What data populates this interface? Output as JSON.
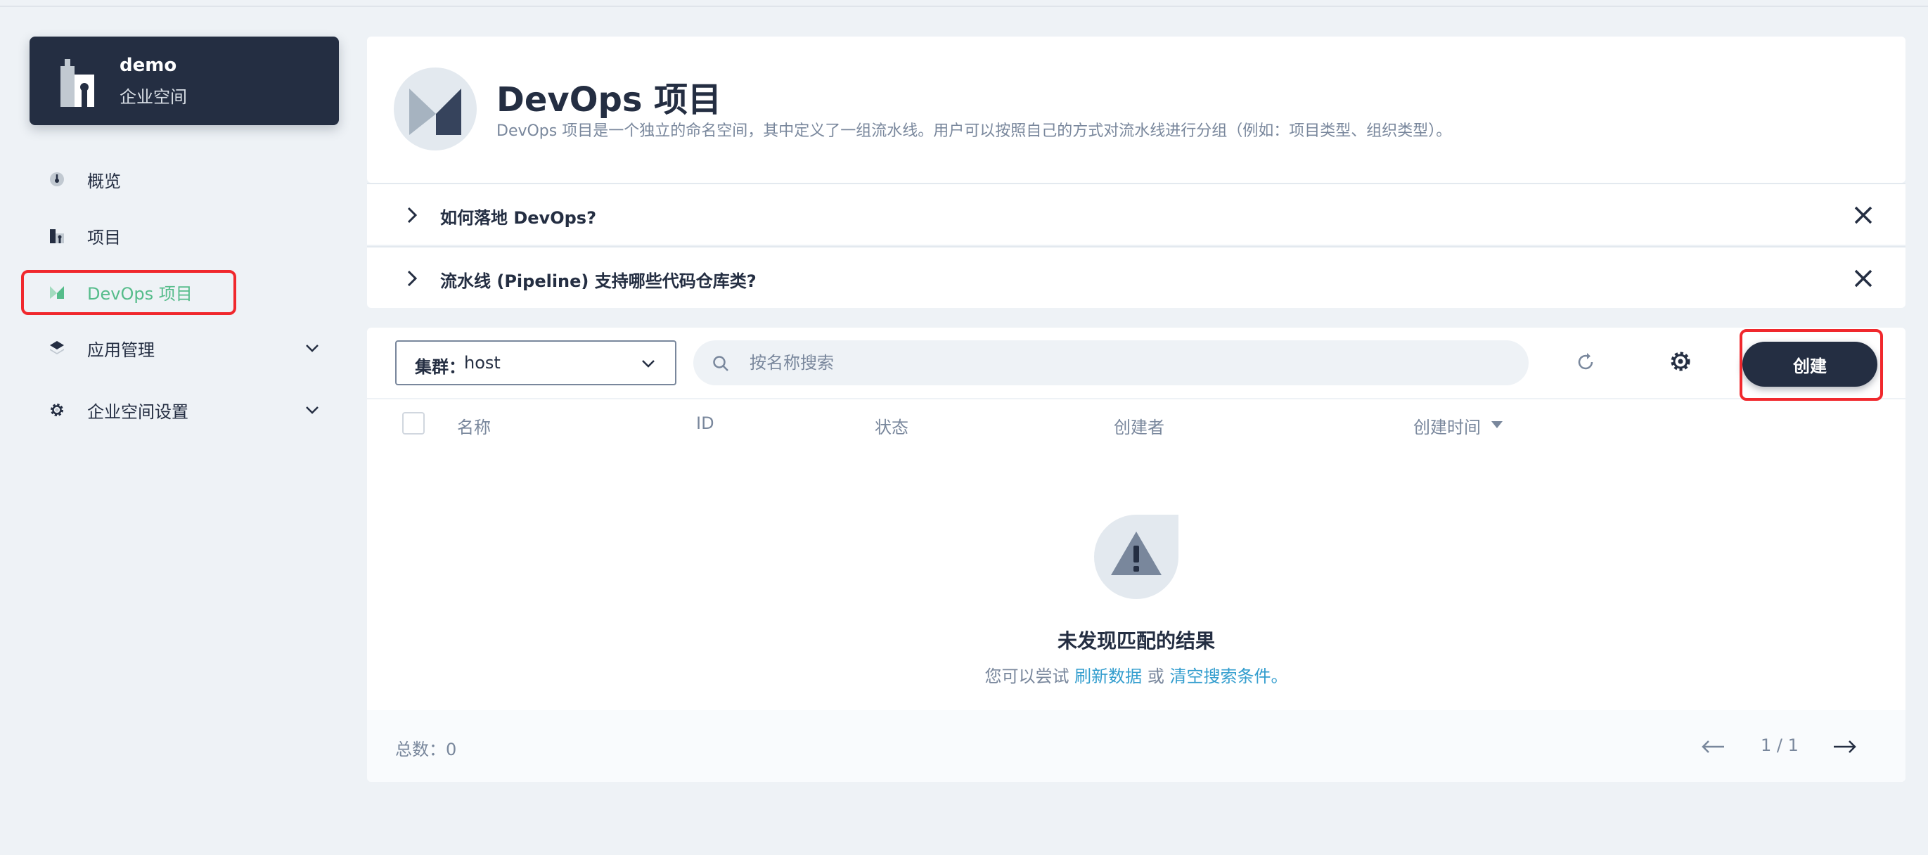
{
  "workspace": {
    "name": "demo",
    "subtitle": "企业空间",
    "icon": "building-icon"
  },
  "sidebar": {
    "items": [
      {
        "label": "概览",
        "icon": "dashboard-icon"
      },
      {
        "label": "项目",
        "icon": "project-icon"
      },
      {
        "label": "DevOps 项目",
        "icon": "devops-icon",
        "active": true
      },
      {
        "label": "应用管理",
        "icon": "layers-icon",
        "expandable": true
      },
      {
        "label": "企业空间设置",
        "icon": "gear-icon",
        "expandable": true
      }
    ]
  },
  "header": {
    "title": "DevOps 项目",
    "description": "DevOps 项目是一个独立的命名空间，其中定义了一组流水线。用户可以按照自己的方式对流水线进行分组（例如：项目类型、组织类型）。"
  },
  "faq": [
    {
      "question": "如何落地 DevOps?"
    },
    {
      "question": "流水线 (Pipeline) 支持哪些代码仓库类?"
    }
  ],
  "toolbar": {
    "cluster_label": "集群：",
    "cluster_value": "host",
    "search_placeholder": "按名称搜索",
    "create_label": "创建"
  },
  "table": {
    "columns": [
      "名称",
      "ID",
      "状态",
      "创建者",
      "创建时间"
    ]
  },
  "empty": {
    "title": "未发现匹配的结果",
    "hint_prefix": "您可以尝试",
    "refresh_link": "刷新数据",
    "or": "或",
    "clear_link": "清空搜索条件。"
  },
  "footer": {
    "total": "总数：0",
    "page": "1 / 1"
  },
  "colors": {
    "dark": "#242e42",
    "accent_green": "#55bc8a",
    "link_blue": "#329dce",
    "highlight_red": "#f0282d",
    "muted": "#79879c"
  }
}
